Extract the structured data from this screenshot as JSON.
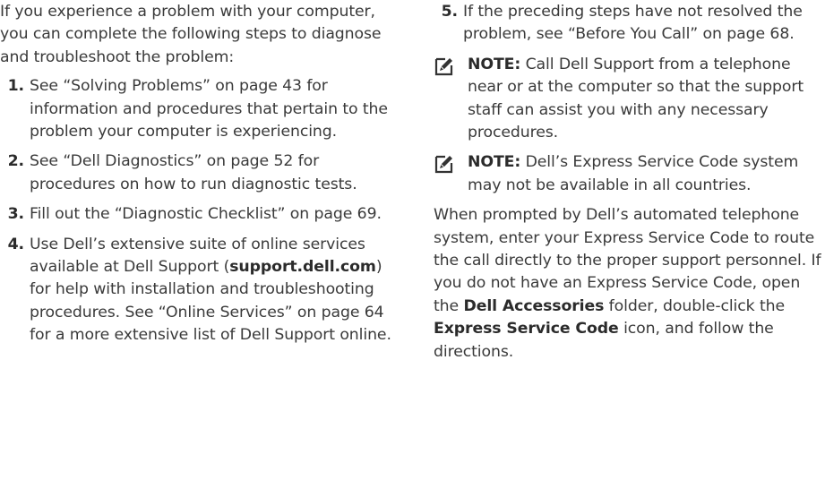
{
  "left": {
    "intro": "If you experience a problem with your computer, you can complete the following steps to diagnose and troubleshoot the problem:",
    "steps": [
      {
        "num": "1.",
        "text": "See “Solving Problems” on page 43 for information and procedures that pertain to the problem your computer is experiencing."
      },
      {
        "num": "2.",
        "text": "See “Dell Diagnostics” on page 52 for procedures on how to run diagnostic tests."
      },
      {
        "num": "3.",
        "text": "Fill out the “Diagnostic Checklist” on page 69."
      },
      {
        "num": "4.",
        "pre": "Use Dell’s extensive suite of online services available at Dell Support (",
        "bold": "support.dell.com",
        "post": ") for help with installation and troubleshooting procedures. See “Online Services” on page 64 for a more extensive list of Dell Support online."
      }
    ]
  },
  "right": {
    "step5": {
      "num": "5.",
      "text": "If the preceding steps have not resolved the problem, see “Before You Call” on page 68."
    },
    "notes": [
      {
        "label": "NOTE:",
        "text": " Call Dell Support from a telephone near or at the computer so that the support staff can assist you with any necessary procedures."
      },
      {
        "label": "NOTE:",
        "text": " Dell’s Express Service Code system may not be available in all countries."
      }
    ],
    "closing": {
      "t1": "When prompted by Dell’s automated telephone system, enter your Express Service Code to route the call directly to the proper support personnel. If you do not have an Express Service Code, open the ",
      "b1": "Dell Accessories",
      "t2": " folder, double-click the ",
      "b2": "Express Service Code",
      "t3": " icon, and follow the directions."
    }
  },
  "icons": {
    "note": "pencil-note-icon"
  },
  "colors": {
    "text": "#3a3a3a",
    "icon": "#333333"
  }
}
